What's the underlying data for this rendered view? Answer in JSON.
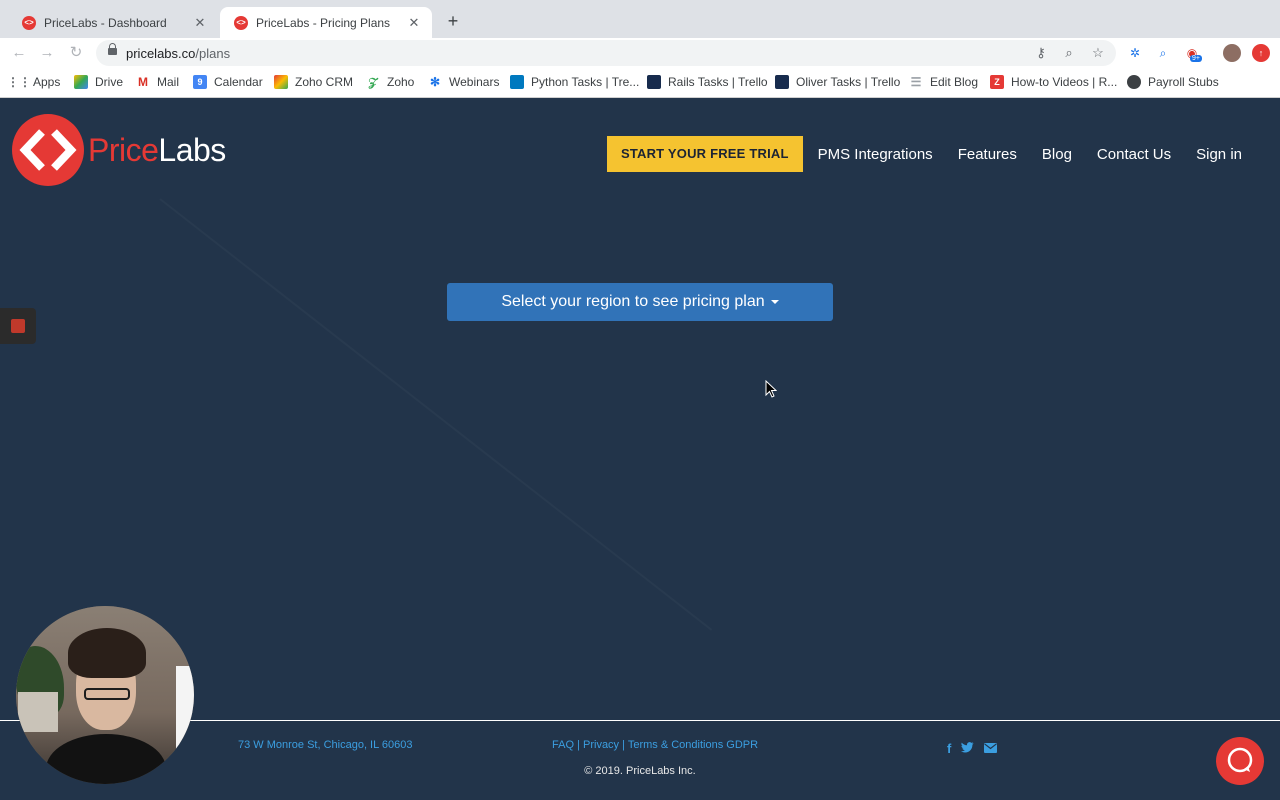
{
  "browser": {
    "tabs": [
      {
        "title": "PriceLabs - Dashboard",
        "active": false
      },
      {
        "title": "PriceLabs - Pricing Plans",
        "active": true
      }
    ],
    "url_domain": "pricelabs.co",
    "url_path": "/plans",
    "bookmarks": [
      {
        "label": "Apps",
        "icon": "apps-grid-icon"
      },
      {
        "label": "Drive",
        "icon": "drive-icon"
      },
      {
        "label": "Mail",
        "icon": "gmail-icon"
      },
      {
        "label": "Calendar",
        "icon": "calendar-icon"
      },
      {
        "label": "Zoho CRM",
        "icon": "zoho-crm-icon"
      },
      {
        "label": "Zoho",
        "icon": "zoho-icon"
      },
      {
        "label": "Webinars",
        "icon": "webinars-icon"
      },
      {
        "label": "Python Tasks | Tre...",
        "icon": "trello-icon"
      },
      {
        "label": "Rails Tasks | Trello",
        "icon": "trello-icon"
      },
      {
        "label": "Oliver Tasks | Trello",
        "icon": "trello-icon"
      },
      {
        "label": "Edit Blog",
        "icon": "blog-icon"
      },
      {
        "label": "How-to Videos | R...",
        "icon": "video-icon"
      },
      {
        "label": "Payroll Stubs",
        "icon": "globe-icon"
      }
    ],
    "extension_badge": "9+"
  },
  "header": {
    "logo_price": "Price",
    "logo_labs": "Labs",
    "cta_label": "START YOUR FREE TRIAL",
    "nav": [
      "PMS Integrations",
      "Features",
      "Blog",
      "Contact Us",
      "Sign in"
    ]
  },
  "main": {
    "region_button_label": "Select your region to see pricing plan"
  },
  "footer": {
    "address": "73 W Monroe St, Chicago, IL 60603",
    "links": [
      "FAQ",
      "Privacy",
      "Terms & Conditions",
      "GDPR"
    ],
    "separator": "|",
    "copyright": "© 2019. PriceLabs Inc.",
    "social_icons": [
      "facebook-icon",
      "twitter-icon",
      "email-icon"
    ]
  },
  "colors": {
    "page_bg": "#22344a",
    "brand_red": "#e53935",
    "cta_yellow": "#f5c330",
    "region_button_blue": "#3173b8",
    "footer_link_blue": "#3b9ee0"
  }
}
